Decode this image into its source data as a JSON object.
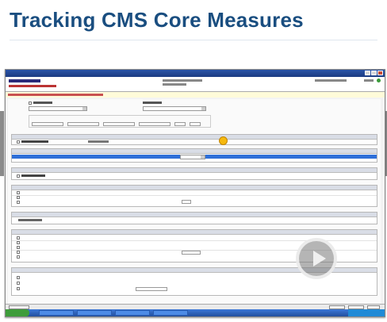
{
  "slide": {
    "title": "Tracking CMS Core Measures"
  },
  "colors": {
    "title": "#1a4e80",
    "window_titlebar": "#1c3b82",
    "selection": "#2e6fd8",
    "cursor_highlight": "#f6b90e",
    "taskbar": "#224f9e"
  },
  "icons": {
    "play": "play-icon",
    "cursor": "cursor-highlight-icon"
  }
}
